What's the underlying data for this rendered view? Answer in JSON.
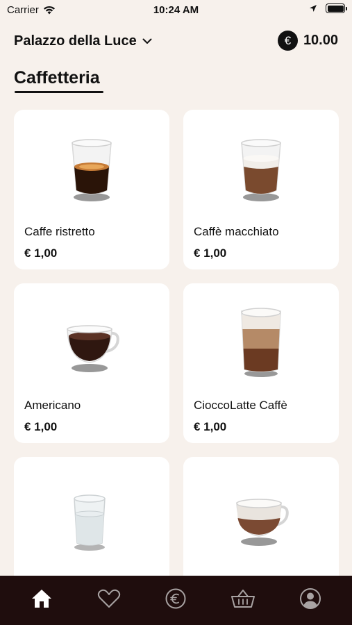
{
  "status_bar": {
    "carrier": "Carrier",
    "time": "10:24 AM"
  },
  "header": {
    "location": "Palazzo della Luce",
    "currency_symbol": "€",
    "balance": "10.00"
  },
  "section": {
    "title": "Caffetteria"
  },
  "products": [
    {
      "name": "Caffe ristretto",
      "price": "€ 1,00",
      "icon": "espresso-glass"
    },
    {
      "name": "Caffè macchiato",
      "price": "€ 1,00",
      "icon": "macchiato-glass"
    },
    {
      "name": "Americano",
      "price": "€ 1,00",
      "icon": "americano-cup"
    },
    {
      "name": "CioccoLatte Caffè",
      "price": "€ 1,00",
      "icon": "tall-latte-glass"
    },
    {
      "name": "",
      "price": "",
      "icon": "water-glass"
    },
    {
      "name": "",
      "price": "",
      "icon": "cappuccino-cup"
    }
  ],
  "tabbar": {
    "tabs": [
      {
        "icon": "home-icon",
        "active": true
      },
      {
        "icon": "heart-icon",
        "active": false
      },
      {
        "icon": "euro-coin-icon",
        "active": false
      },
      {
        "icon": "basket-icon",
        "active": false
      },
      {
        "icon": "profile-icon",
        "active": false
      }
    ],
    "active_color": "#ffffff",
    "inactive_color": "#a9a3a3"
  }
}
